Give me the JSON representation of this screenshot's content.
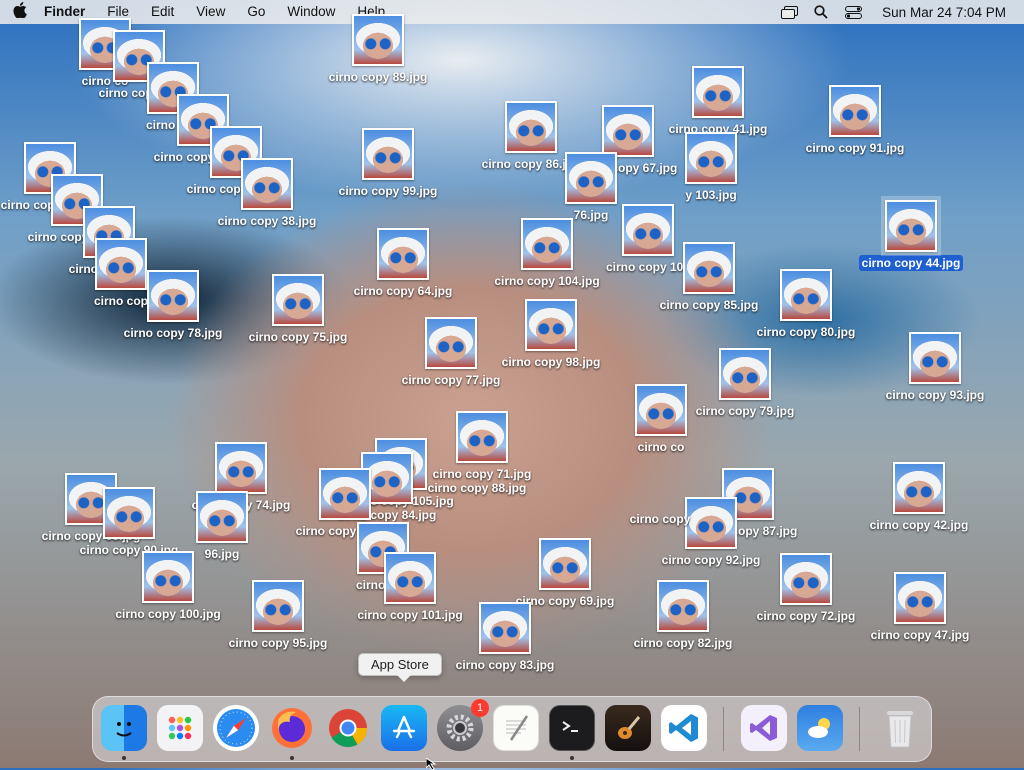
{
  "menubar": {
    "app": "Finder",
    "items": [
      "File",
      "Edit",
      "View",
      "Go",
      "Window",
      "Help"
    ],
    "clock": "Sun Mar 24  7:04 PM"
  },
  "desktop": {
    "icons": [
      "cirno copy 89.jpg",
      "cirno co",
      "cirno copy 63.",
      "cirno cop",
      "cirno copy 81.jpg",
      "cirno copy 83.jpg",
      "cirno copy 38.jpg",
      "cirno copy 62.jpg",
      "cirno copy 61.jpg",
      "cirno copy 46.",
      "cirno cop",
      "cirno copy 78.jpg",
      "cirno copy 99.jpg",
      "cirno copy 64.jpg",
      "cirno copy 75.jpg",
      "cirno copy 86.jpg",
      "cirno copy 67.jpg",
      "cirno copy 41.jpg",
      "cirno copy 91.jpg",
      "y 103.jpg",
      "cirno copy 44.jpg",
      "76.jpg",
      "cirno copy 104.jpg",
      "cirno copy 102",
      "cirno copy 85.jpg",
      "cirno copy 80.jpg",
      "cirno copy 77.jpg",
      "cirno copy 98.jpg",
      "cirno copy 79.jpg",
      "cirno copy 93.jpg",
      "cirno copy 71.jpg",
      "cirno copy 88.jpg",
      "cirno copy 105.jpg",
      "cirno copy 84.jpg",
      "cirno copy 74.jpg",
      "cirno copy 65.jpg",
      "cirno copy 90.jpg",
      "96.jpg",
      "cirno copy 66.jpg",
      "cirno co",
      "cirno copy 87.jpg",
      "cirno copy 92.jpg",
      "cirno copy 42.jpg",
      "cirno copy 100.jpg",
      "cirno cop",
      "cirno copy 101.jpg",
      "cirno copy 69.jpg",
      "cirno copy 72.jpg",
      "cirno copy 95.jpg",
      "cirno copy 83.jpg",
      "cirno copy 82.jpg",
      "cirno copy 47.jpg",
      "cirno copy"
    ],
    "selected": "cirno copy 44.jpg"
  },
  "tooltip": "App Store",
  "dock": {
    "apps": [
      "finder-icon",
      "launchpad-icon",
      "safari-icon",
      "firefox-icon",
      "chrome-icon",
      "app-store-icon",
      "system-settings-icon",
      "textedit-icon",
      "terminal-icon",
      "garageband-icon",
      "vscode-icon",
      "visual-studio-icon",
      "weather-icon",
      "trash-icon"
    ],
    "settings_badge": "1"
  }
}
